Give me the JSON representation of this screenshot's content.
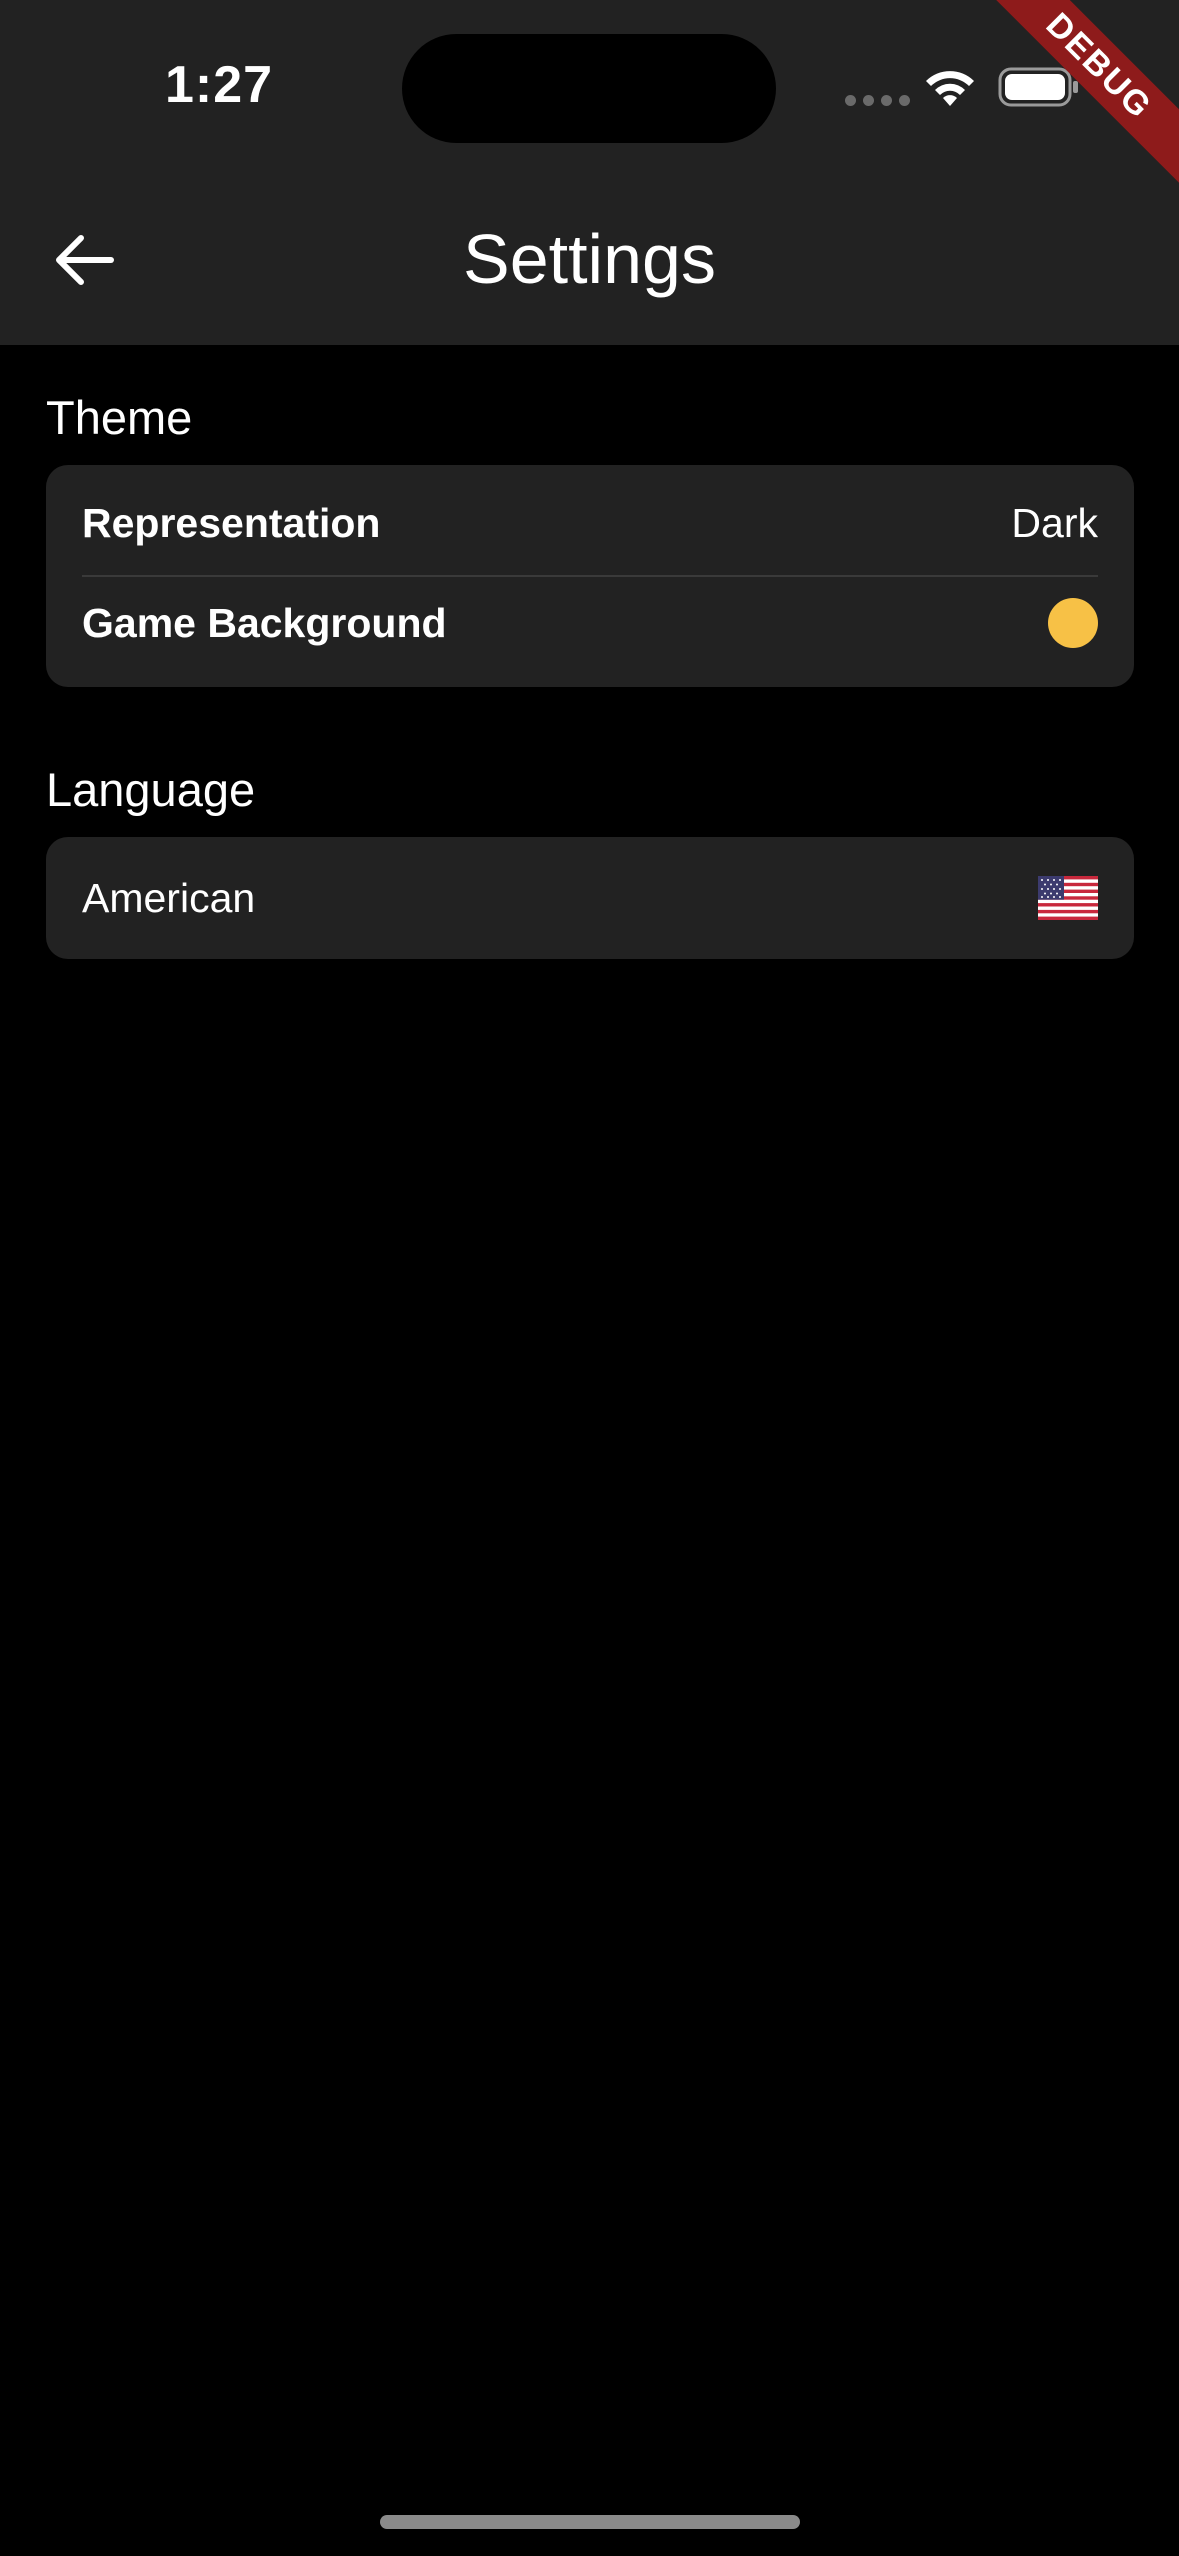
{
  "status_bar": {
    "time": "1:27"
  },
  "debug_banner": "DEBUG",
  "header": {
    "title": "Settings",
    "back_icon": "arrow-left-icon"
  },
  "sections": {
    "theme": {
      "label": "Theme",
      "representation_label": "Representation",
      "representation_value": "Dark",
      "game_background_label": "Game Background",
      "game_background_color": "#f7c146"
    },
    "language": {
      "label": "Language",
      "selected": "American",
      "flag_icon": "us-flag-icon"
    }
  },
  "colors": {
    "background": "#000000",
    "surface": "#222222",
    "text": "#ffffff",
    "debug": "#8e1b1b"
  }
}
